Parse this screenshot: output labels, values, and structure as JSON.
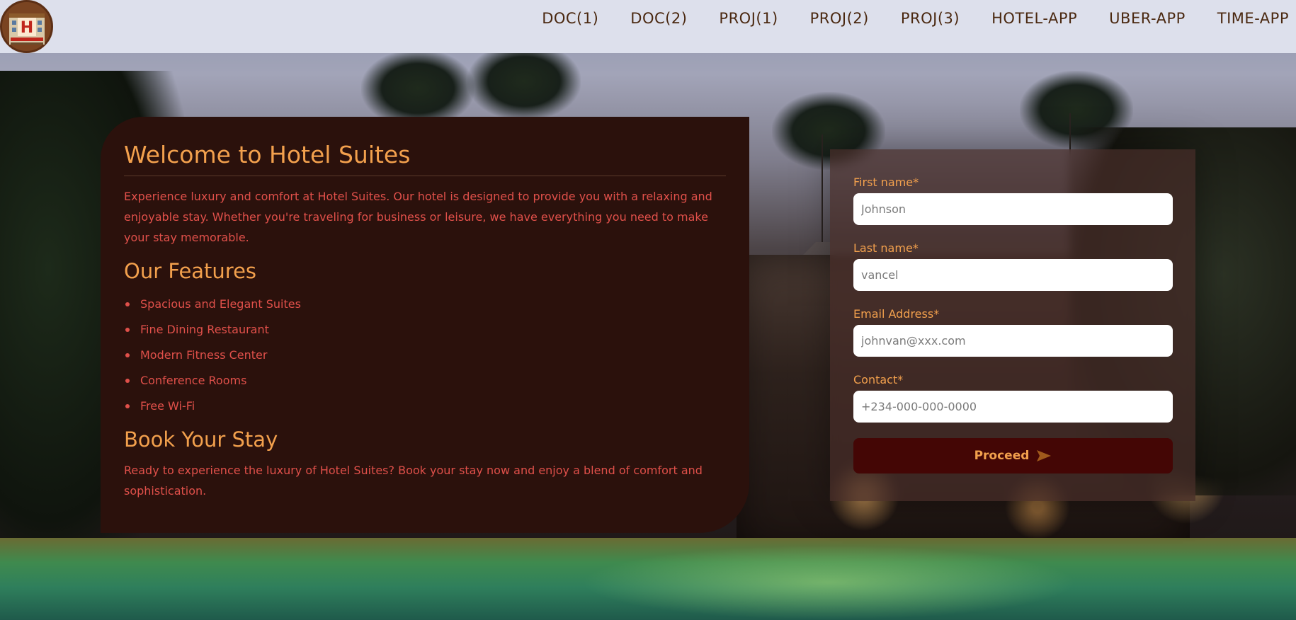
{
  "nav": {
    "logo_letter": "H",
    "links": [
      "DOC(1)",
      "DOC(2)",
      "PROJ(1)",
      "PROJ(2)",
      "PROJ(3)",
      "HOTEL-APP",
      "UBER-APP",
      "TIME-APP"
    ]
  },
  "info": {
    "title": "Welcome to Hotel Suites",
    "intro": "Experience luxury and comfort at Hotel Suites. Our hotel is designed to provide you with a relaxing and enjoyable stay. Whether you're traveling for business or leisure, we have everything you need to make your stay memorable.",
    "features_title": "Our Features",
    "features": [
      "Spacious and Elegant Suites",
      "Fine Dining Restaurant",
      "Modern Fitness Center",
      "Conference Rooms",
      "Free Wi-Fi"
    ],
    "book_title": "Book Your Stay",
    "book_text": "Ready to experience the luxury of Hotel Suites? Book your stay now and enjoy a blend of comfort and sophistication."
  },
  "form": {
    "first_name": {
      "label": "First name*",
      "placeholder": "Johnson"
    },
    "last_name": {
      "label": "Last name*",
      "placeholder": "vancel"
    },
    "email": {
      "label": "Email Address*",
      "placeholder": "johnvan@xxx.com"
    },
    "contact": {
      "label": "Contact*",
      "placeholder": "+234-000-000-0000"
    },
    "submit_label": "Proceed"
  },
  "colors": {
    "accent": "#f2a04d",
    "body_text": "#e0504a",
    "card_bg": "#2b110c",
    "button_bg": "#440605",
    "nav_text": "#4a2810"
  }
}
